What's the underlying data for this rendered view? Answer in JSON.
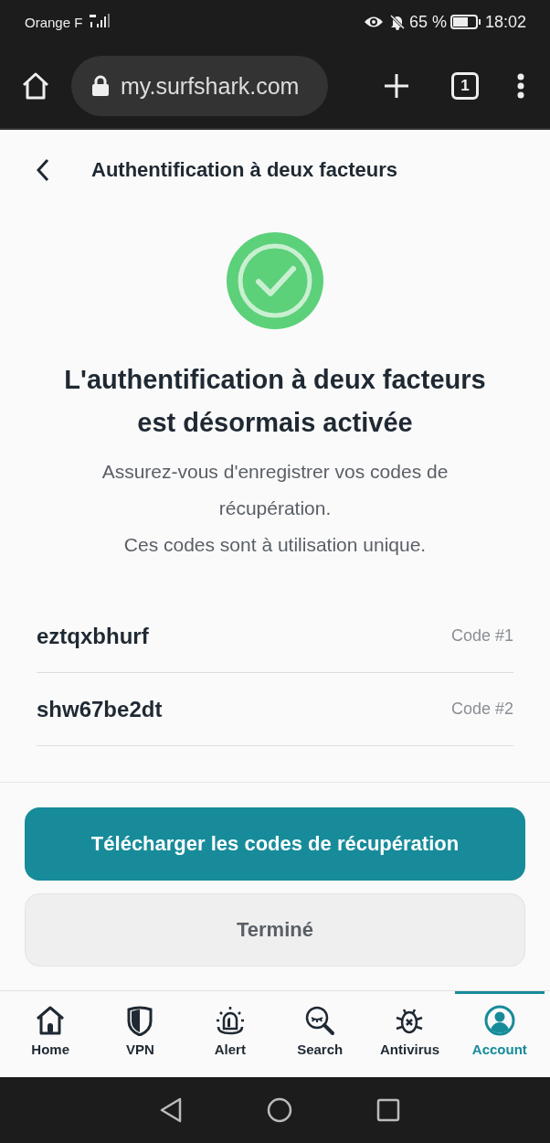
{
  "status_bar": {
    "carrier": "Orange F",
    "battery": "65 %",
    "time": "18:02"
  },
  "browser": {
    "url": "my.surfshark.com",
    "tab_count": "1"
  },
  "header": {
    "title": "Authentification à deux facteurs"
  },
  "heading": "L'authentification à deux facteurs est désormais activée",
  "message": [
    "Assurez-vous d'enregistrer vos codes de récupération.",
    "Ces codes sont à utilisation unique."
  ],
  "codes": [
    {
      "code": "eztqxbhurf",
      "label": "Code #1"
    },
    {
      "code": "shw67be2dt",
      "label": "Code #2"
    }
  ],
  "buttons": [
    {
      "label": "Télécharger les codes de récupération",
      "kind": "primary"
    },
    {
      "label": "Terminé",
      "kind": "secondary"
    }
  ],
  "nav": [
    {
      "label": "Home",
      "kind": "home",
      "selected": false
    },
    {
      "label": "VPN",
      "kind": "shield",
      "selected": false
    },
    {
      "label": "Alert",
      "kind": "alert",
      "selected": false
    },
    {
      "label": "Search",
      "kind": "search",
      "selected": false
    },
    {
      "label": "Antivirus",
      "kind": "bug",
      "selected": false
    },
    {
      "label": "Account",
      "kind": "account",
      "selected": true
    }
  ]
}
